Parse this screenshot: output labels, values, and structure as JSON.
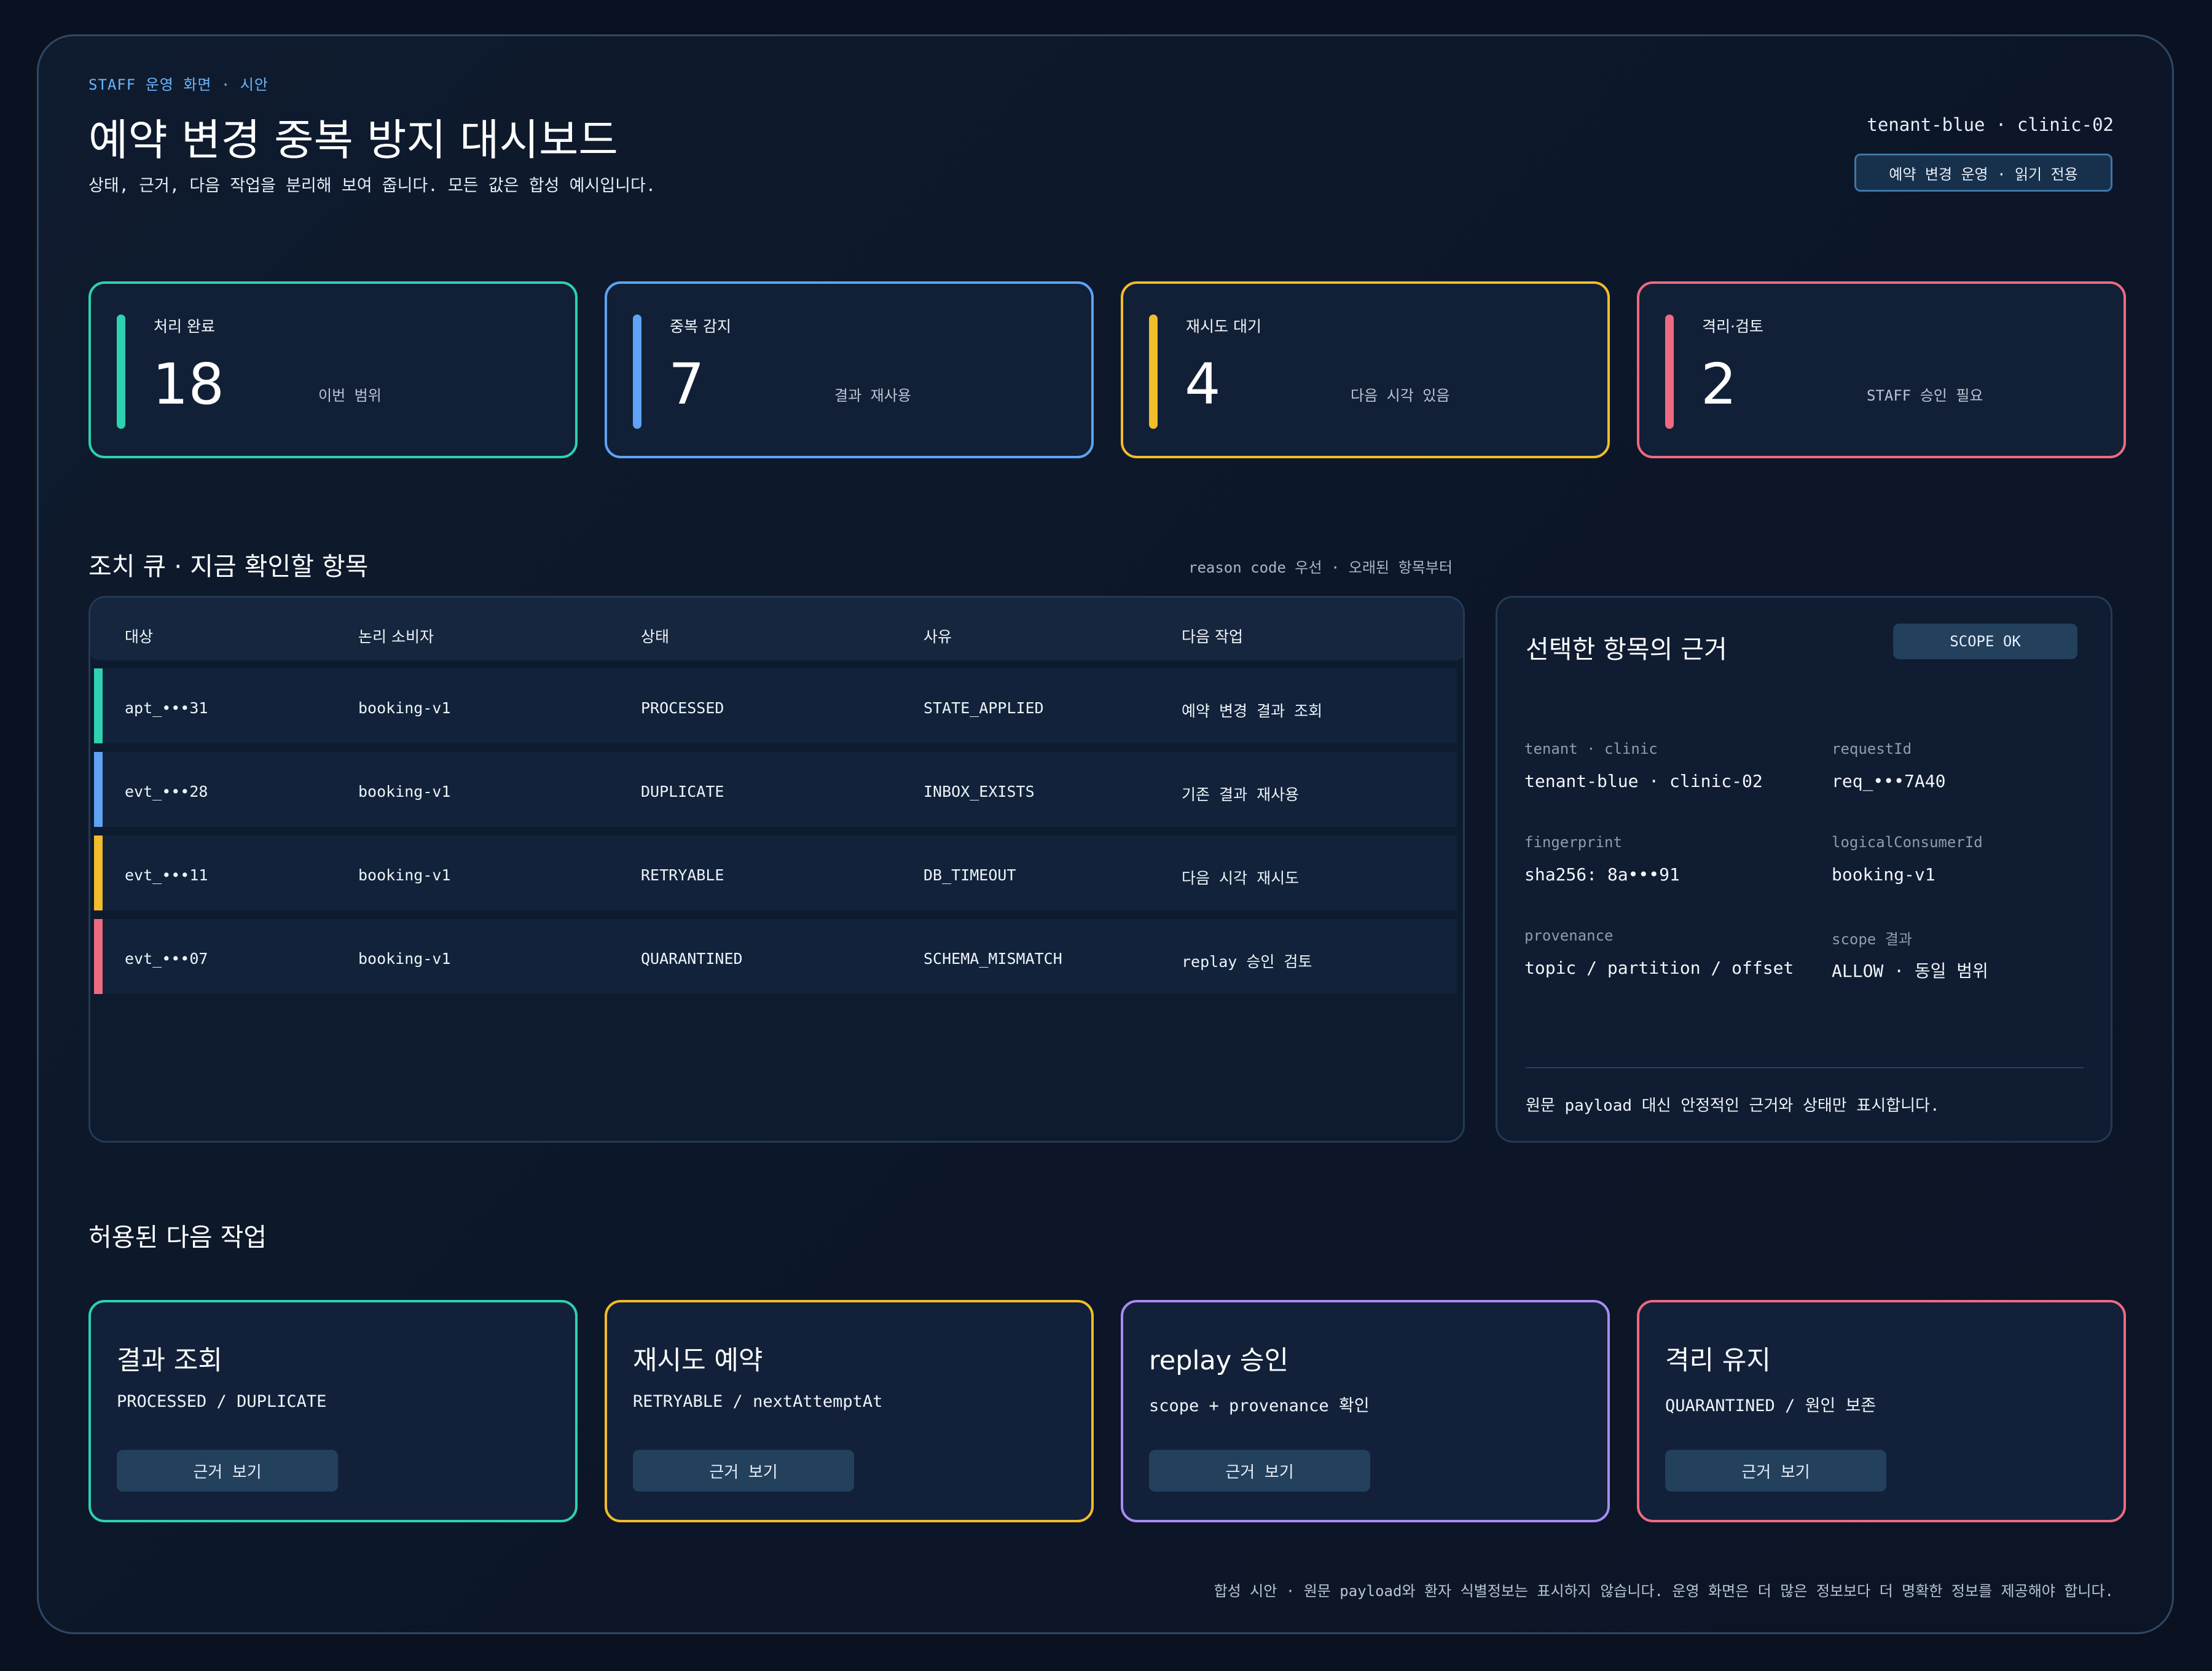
{
  "header": {
    "eyebrow": "STAFF 운영 화면 · 시안",
    "title": "예약 변경 중복 방지 대시보드",
    "subtitle": "상태, 근거, 다음 작업을 분리해 보여 줍니다. 모든 값은 합성 예시입니다.",
    "tenant": "tenant-blue · clinic-02",
    "mode_badge": "예약 변경 운영 · 읽기 전용"
  },
  "colors": {
    "green": "#2ed1b0",
    "blue": "#5ea3f5",
    "yellow": "#f2bc2a",
    "red": "#ee6a80",
    "purple": "#a98bf2"
  },
  "stats": [
    {
      "label": "처리 완료",
      "value": "18",
      "note": "이번 범위",
      "color": "#2ed1b0"
    },
    {
      "label": "중복 감지",
      "value": "7",
      "note": "결과 재사용",
      "color": "#5ea3f5"
    },
    {
      "label": "재시도 대기",
      "value": "4",
      "note": "다음 시각 있음",
      "color": "#f2bc2a"
    },
    {
      "label": "격리·검토",
      "value": "2",
      "note": "STAFF 승인 필요",
      "color": "#ee6a80"
    }
  ],
  "queue": {
    "title": "조치 큐 · 지금 확인할 항목",
    "note": "reason code 우선 · 오래된 항목부터",
    "columns": [
      "대상",
      "논리 소비자",
      "상태",
      "사유",
      "다음 작업"
    ],
    "rows": [
      {
        "target": "apt_•••31",
        "consumer": "booking-v1",
        "status": "PROCESSED",
        "reason": "STATE_APPLIED",
        "next": "예약 변경 결과 조회",
        "color": "#2ed1b0"
      },
      {
        "target": "evt_•••28",
        "consumer": "booking-v1",
        "status": "DUPLICATE",
        "reason": "INBOX_EXISTS",
        "next": "기존 결과 재사용",
        "color": "#5ea3f5"
      },
      {
        "target": "evt_•••11",
        "consumer": "booking-v1",
        "status": "RETRYABLE",
        "reason": "DB_TIMEOUT",
        "next": "다음 시각 재시도",
        "color": "#f2bc2a"
      },
      {
        "target": "evt_•••07",
        "consumer": "booking-v1",
        "status": "QUARANTINED",
        "reason": "SCHEMA_MISMATCH",
        "next": "replay 승인 검토",
        "color": "#ee6a80"
      }
    ]
  },
  "detail": {
    "title": "선택한 항목의 근거",
    "badge": "SCOPE OK",
    "fields": [
      {
        "key": "tenant · clinic",
        "value": "tenant-blue · clinic-02"
      },
      {
        "key": "requestId",
        "value": "req_•••7A40"
      },
      {
        "key": "fingerprint",
        "value": "sha256: 8a•••91"
      },
      {
        "key": "logicalConsumerId",
        "value": "booking-v1"
      },
      {
        "key": "provenance",
        "value": "topic / partition / offset"
      },
      {
        "key": "scope 결과",
        "value": "ALLOW · 동일 범위"
      }
    ],
    "footnote": "원문 payload 대신 안정적인 근거와 상태만 표시합니다."
  },
  "actions": {
    "title": "허용된 다음 작업",
    "items": [
      {
        "title": "결과 조회",
        "desc": "PROCESSED / DUPLICATE",
        "button": "근거 보기",
        "color": "#2ed1b0"
      },
      {
        "title": "재시도 예약",
        "desc": "RETRYABLE / nextAttemptAt",
        "button": "근거 보기",
        "color": "#f2bc2a"
      },
      {
        "title": "replay 승인",
        "desc": "scope + provenance 확인",
        "button": "근거 보기",
        "color": "#a98bf2"
      },
      {
        "title": "격리 유지",
        "desc": "QUARANTINED / 원인 보존",
        "button": "근거 보기",
        "color": "#ee6a80"
      }
    ]
  },
  "footer": "합성 시안 · 원문 payload와 환자 식별정보는 표시하지 않습니다. 운영 화면은 더 많은 정보보다 더 명확한 정보를 제공해야 합니다."
}
